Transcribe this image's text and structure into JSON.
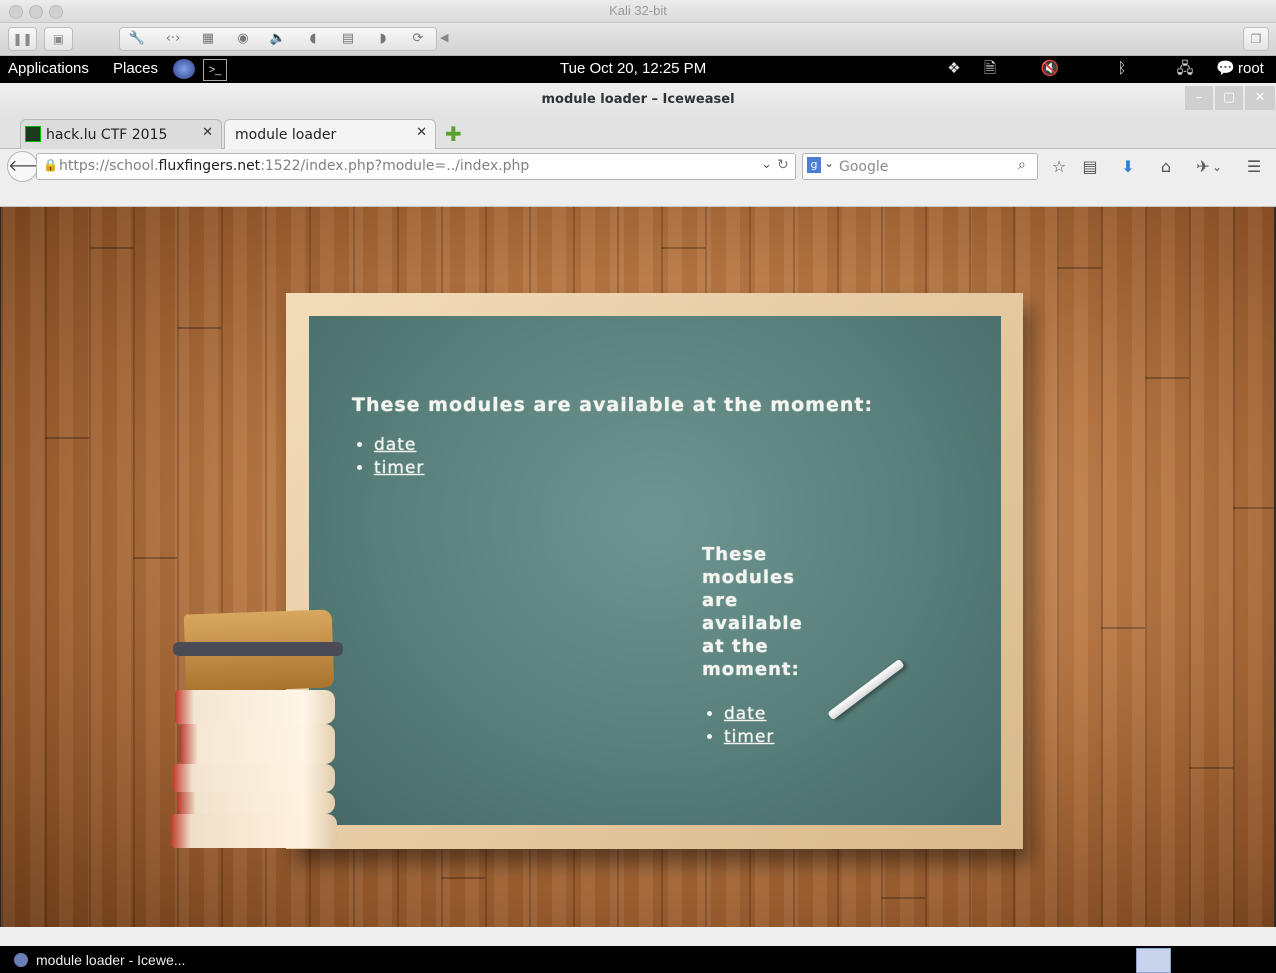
{
  "vm_window": {
    "title": "Kali 32-bit",
    "toolbar_icons": [
      "pause-icon",
      "snapshot-icon",
      "wrench-icon",
      "code-icon",
      "disk-icon",
      "camera-icon",
      "sound-icon",
      "mouse-icon",
      "lock-icon",
      "usb-icon",
      "refresh-icon",
      "collapse-icon"
    ]
  },
  "gnome_panel": {
    "applications": "Applications",
    "places": "Places",
    "clock": "Tue Oct 20, 12:25 PM",
    "user": "root"
  },
  "browser": {
    "window_title": "module loader – Iceweasel",
    "tabs": [
      {
        "label": "hack.lu CTF 2015",
        "active": false
      },
      {
        "label": "module loader",
        "active": true
      }
    ],
    "url": {
      "prefix": "https://school.",
      "domain": "fluxfingers.net",
      "suffix": ":1522/index.php?module=../index.php"
    },
    "search_placeholder": "Google"
  },
  "page": {
    "heading_1": "These modules are available at the moment:",
    "modules_1": [
      "date",
      "timer"
    ],
    "heading_2": "These modules are available at the moment:",
    "modules_2": [
      "date",
      "timer"
    ]
  },
  "taskbar": {
    "item_label": "module loader - Icewe..."
  }
}
